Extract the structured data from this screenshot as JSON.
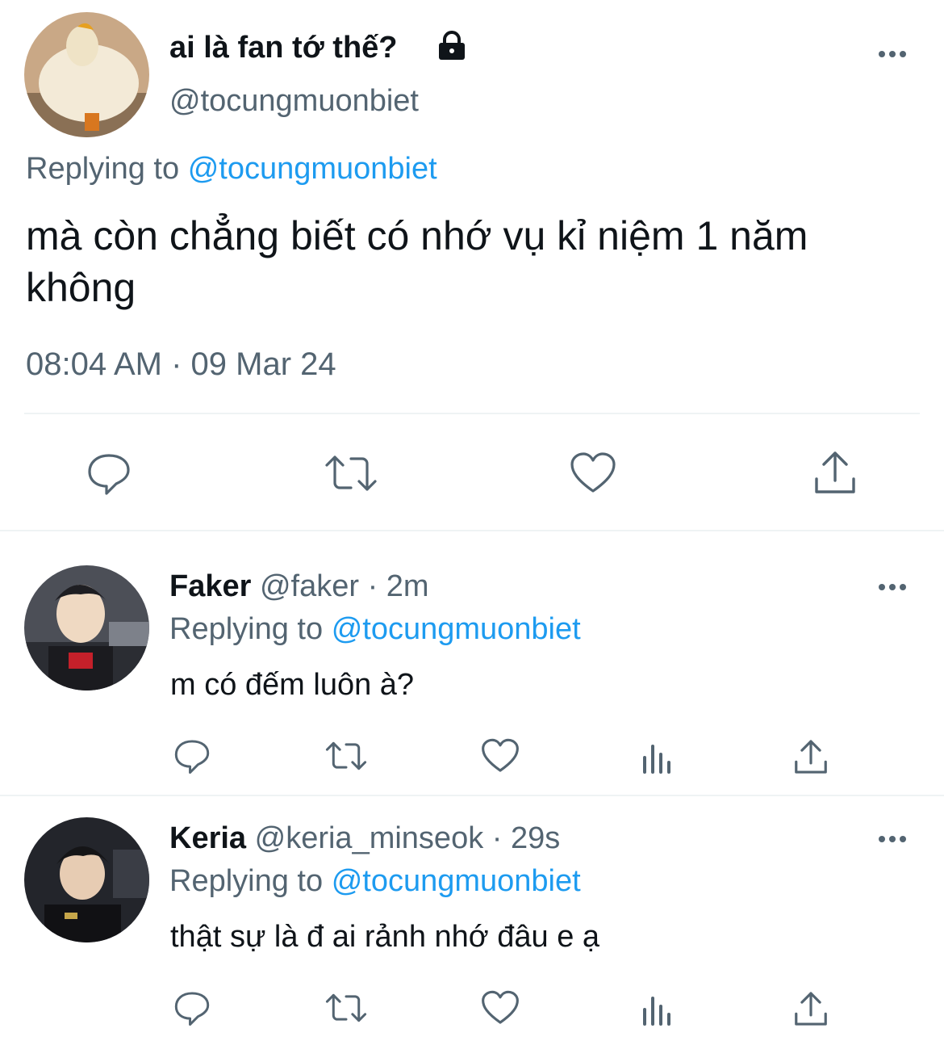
{
  "main_tweet": {
    "display_name": "ai là fan tớ thế?",
    "handle": "@tocungmuonbiet",
    "replying_prefix": "Replying to",
    "replying_to": "@tocungmuonbiet",
    "text": "mà còn chẳng biết có nhớ vụ kỉ niệm 1 năm không",
    "timestamp": "08:04 AM · 09 Mar 24"
  },
  "replies": [
    {
      "display_name": "Faker",
      "meta": "@faker · 2m",
      "replying_prefix": "Replying to",
      "replying_to": "@tocungmuonbiet",
      "text": "m có đếm luôn à?"
    },
    {
      "display_name": "Keria",
      "meta": "@keria_minseok · 29s",
      "replying_prefix": "Replying to",
      "replying_to": "@tocungmuonbiet",
      "text": "thật sự là đ ai rảnh nhớ đâu e ạ"
    }
  ],
  "icons": {
    "reply": "speech-bubble-icon",
    "retweet": "retweet-arrows-icon",
    "like": "heart-icon",
    "views": "bar-chart-icon",
    "share": "upload-arrow-icon",
    "more": "three-dots-icon",
    "protected": "lock-icon"
  },
  "colors": {
    "text": "#0f1419",
    "muted": "#536471",
    "link": "#1d9bf0",
    "divider": "#eff3f4"
  }
}
